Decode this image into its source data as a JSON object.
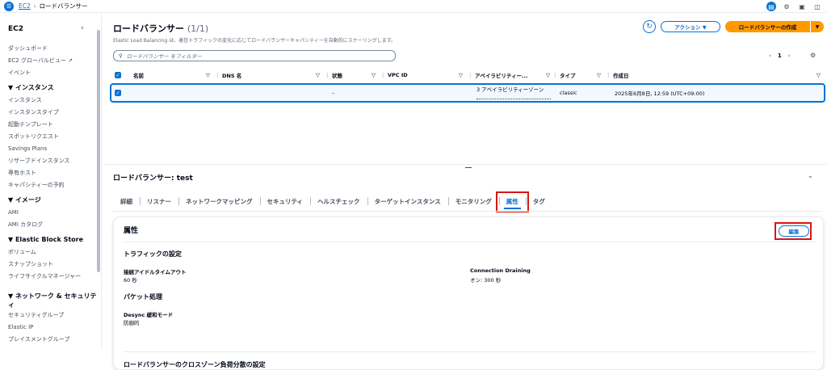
{
  "breadcrumb": {
    "root": "EC2",
    "current": "ロードバランサー"
  },
  "sidebar": {
    "title": "EC2",
    "items": [
      {
        "label": "ダッシュボード",
        "type": "item"
      },
      {
        "label": "EC2 グローバルビュー ↗",
        "type": "item"
      },
      {
        "label": "イベント",
        "type": "item"
      },
      {
        "label": "▼ インスタンス",
        "type": "section"
      },
      {
        "label": "インスタンス",
        "type": "item"
      },
      {
        "label": "インスタンスタイプ",
        "type": "item"
      },
      {
        "label": "起動テンプレート",
        "type": "item"
      },
      {
        "label": "スポットリクエスト",
        "type": "item"
      },
      {
        "label": "Savings Plans",
        "type": "item"
      },
      {
        "label": "リザーブドインスタンス",
        "type": "item"
      },
      {
        "label": "専有ホスト",
        "type": "item"
      },
      {
        "label": "キャパシティーの予約",
        "type": "item"
      },
      {
        "label": "▼ イメージ",
        "type": "section"
      },
      {
        "label": "AMI",
        "type": "item"
      },
      {
        "label": "AMI カタログ",
        "type": "item"
      },
      {
        "label": "▼ Elastic Block Store",
        "type": "section"
      },
      {
        "label": "ボリューム",
        "type": "item"
      },
      {
        "label": "スナップショット",
        "type": "item"
      },
      {
        "label": "ライフサイクルマネージャー",
        "type": "item-tall"
      },
      {
        "label": "▼ ネットワーク & セキュリティ",
        "type": "section-tall"
      },
      {
        "label": "セキュリティグループ",
        "type": "item"
      },
      {
        "label": "Elastic IP",
        "type": "item"
      },
      {
        "label": "プレイスメントグループ",
        "type": "item"
      }
    ]
  },
  "header": {
    "title": "ロードバランサー",
    "count": "(1/1)",
    "description": "Elastic Load Balancing は、着信トラフィックの変化に応じてロードバランサーキャパシティーを自動的にスケーリングします。",
    "actions_label": "アクション ▼",
    "create_label": "ロードバランサーの作成",
    "search_placeholder": "ロードバランサー をフィルター",
    "page_number": "1"
  },
  "table": {
    "columns": [
      "名前",
      "DNS 名",
      "状態",
      "VPC ID",
      "アベイラビリティー...",
      "タイプ",
      "作成日"
    ],
    "rows": [
      {
        "name": "",
        "dns": "",
        "state": "–",
        "vpc": "",
        "az": "3 アベイラビリティーゾーン",
        "type": "classic",
        "created": "2025年6月8日, 12:59 (UTC+09:00)"
      }
    ]
  },
  "detail": {
    "title": "ロードバランサー: test",
    "tabs": [
      "詳細",
      "リスナー",
      "ネットワークマッピング",
      "セキュリティ",
      "ヘルスチェック",
      "ターゲットインスタンス",
      "モニタリング",
      "属性",
      "タグ"
    ],
    "active_tab": "属性",
    "panel": {
      "title": "属性",
      "edit_label": "編集",
      "traffic_heading": "トラフィックの設定",
      "idle_timeout_label": "接続アイドルタイムアウト",
      "idle_timeout_value": "60 秒",
      "draining_label": "Connection Draining",
      "draining_value": "オン: 300 秒",
      "packet_heading": "パケット処理",
      "desync_label": "Desync 緩和モード",
      "desync_value": "防御的",
      "cut_heading": "ロードバランサーのクロスゾーン負荷分散の設定"
    }
  },
  "colors": {
    "accent": "#0972d3",
    "primary_button": "#ff9900",
    "highlight": "#d91515"
  }
}
